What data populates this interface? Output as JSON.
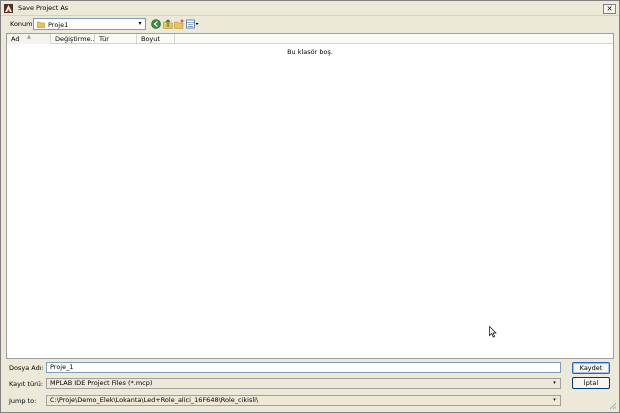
{
  "window": {
    "title": "Save Project As",
    "close_glyph": "✕"
  },
  "toolbar": {
    "location_label": "Konum:",
    "location_value": "Proje1",
    "dropdown_glyph": "▾",
    "icons": [
      "back-icon",
      "up-folder-icon",
      "new-folder-icon",
      "view-menu-icon"
    ]
  },
  "file_list": {
    "columns": [
      "Ad",
      "Değiştirme...",
      "Tür",
      "Boyut"
    ],
    "sort_glyph": "▲",
    "empty_message": "Bu klasör boş."
  },
  "form": {
    "filename_label": "Dosya Adı:",
    "filename_value": "Proje_1",
    "filetype_label": "Kayıt türü:",
    "filetype_value": "MPLAB IDE Project Files (*.mcp)",
    "jumpto_label": "Jump to:",
    "jumpto_value": "C:\\Proje\\Demo_Elek\\Lokanta\\Led+Role_alici_16F648\\Role_cikisli\\"
  },
  "buttons": {
    "save": "Kaydet",
    "cancel": "İptal"
  },
  "colors": {
    "dialog_bg": "#ece9d8",
    "field_border": "#7f9db9",
    "default_button_border": "#2a64c5",
    "folder_yellow": "#e8c25a"
  }
}
